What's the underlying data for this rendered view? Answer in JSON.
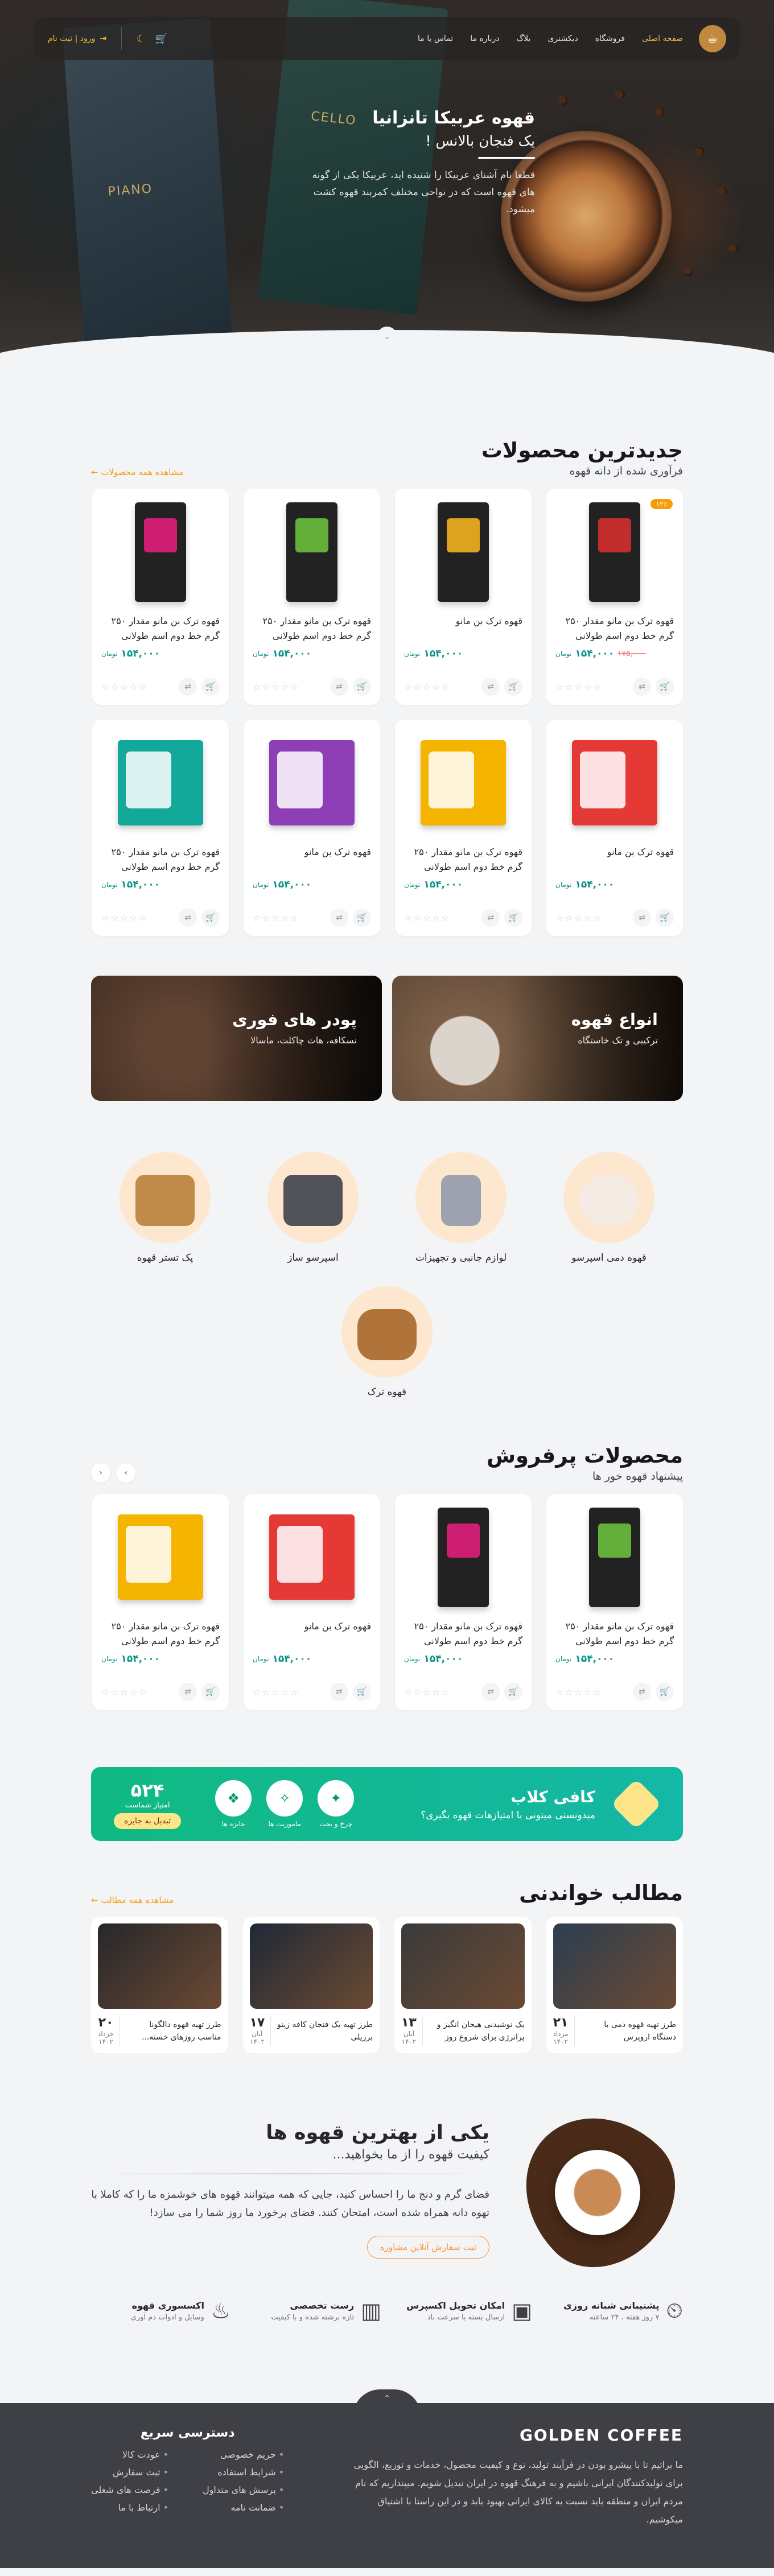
{
  "nav": {
    "menu": [
      "صفحه اصلی",
      "فروشگاه",
      "دیکشنری",
      "بلاگ",
      "درباره ما",
      "تماس با ما"
    ],
    "login": "ورود | ثبت نام"
  },
  "hero": {
    "title": "قهوه عربیکا تانزانیا",
    "subtitle": "یک فنجان بالانس !",
    "desc": "قطعا نام آشنای عربیکا را شنیده اید، عربیکا یکی از گونه های قهوه است که در نواحی مختلف کمربند قهوه کشت میشود.",
    "bag1_label": "PIANO",
    "bag2_label": "CELLO"
  },
  "latest": {
    "title": "جدیدترین محصولات",
    "sub": "فرآوری شده از دانه قهوه",
    "link": "مشاهده همه محصولات",
    "products": [
      {
        "name": "قهوه ترک بن مانو مقدار ۲۵۰ گرم خط دوم اسم طولانی",
        "price": "۱۵۴,۰۰۰",
        "old": "۱۷۵,۰۰۰",
        "badge": "۱۲٪",
        "color": "#d32f2f",
        "kind": "bag"
      },
      {
        "name": "قهوه ترک بن مانو",
        "price": "۱۵۴,۰۰۰",
        "color": "#f2b01e",
        "kind": "bag"
      },
      {
        "name": "قهوه ترک بن مانو مقدار ۲۵۰ گرم خط دوم اسم طولانی",
        "price": "۱۵۴,۰۰۰",
        "color": "#6abf3c",
        "kind": "bag"
      },
      {
        "name": "قهوه ترک بن مانو مقدار ۲۵۰ گرم خط دوم اسم طولانی",
        "price": "۱۵۴,۰۰۰",
        "color": "#e01e7a",
        "kind": "bag"
      },
      {
        "name": "قهوه ترک بن مانو",
        "price": "۱۵۴,۰۰۰",
        "color": "#e53935",
        "kind": "box"
      },
      {
        "name": "قهوه ترک بن مانو مقدار ۲۵۰ گرم خط دوم اسم طولانی",
        "price": "۱۵۴,۰۰۰",
        "color": "#f4b400",
        "kind": "box"
      },
      {
        "name": "قهوه ترک بن مانو",
        "price": "۱۵۴,۰۰۰",
        "color": "#8e3fb5",
        "kind": "box"
      },
      {
        "name": "قهوه ترک بن مانو مقدار ۲۵۰ گرم خط دوم اسم طولانی",
        "price": "۱۵۴,۰۰۰",
        "color": "#12a89a",
        "kind": "box"
      }
    ],
    "unit": "تومان"
  },
  "banners": [
    {
      "title": "انواع قهوه",
      "sub": "ترکیبی و تک خاستگاه"
    },
    {
      "title": "پودر های فوری",
      "sub": "نسکافه، هات چاکلت، ماسالا"
    }
  ],
  "categories": [
    "قهوه دمی اسپرسو",
    "لوازم جانبی و تجهیزات",
    "اسپرسو ساز",
    "پک تستر قهوه",
    "قهوه ترک"
  ],
  "bestsellers": {
    "title": "محصولات پرفروش",
    "sub": "پیشنهاد قهوه خور ها",
    "products": [
      {
        "name": "قهوه ترک بن مانو مقدار ۲۵۰ گرم خط دوم اسم طولانی",
        "price": "۱۵۴,۰۰۰",
        "color": "#6abf3c",
        "kind": "bag"
      },
      {
        "name": "قهوه ترک بن مانو مقدار ۲۵۰ گرم خط دوم اسم طولانی",
        "price": "۱۵۴,۰۰۰",
        "color": "#e01e7a",
        "kind": "bag"
      },
      {
        "name": "قهوه ترک بن مانو",
        "price": "۱۵۴,۰۰۰",
        "color": "#e53935",
        "kind": "box"
      },
      {
        "name": "قهوه ترک بن مانو مقدار ۲۵۰ گرم خط دوم اسم طولانی",
        "price": "۱۵۴,۰۰۰",
        "color": "#f4b400",
        "kind": "box"
      }
    ]
  },
  "club": {
    "title": "کافی کلاب",
    "sub": "میدونستی میتونی با امتیازهات قهوه بگیری؟",
    "acts": [
      "چرخ و بخت",
      "ماموریت ها",
      "جایزه ها"
    ],
    "points": "۵۲۴",
    "points_label": "امتیاز شماست",
    "points_btn": "تبدیل به جایزه"
  },
  "blog": {
    "title": "مطالب خواندنی",
    "link": "مشاهده همه مطالب",
    "posts": [
      {
        "title": "طرز تهیه قهوه دمی با دستگاه اروپرس",
        "day": "۲۱",
        "month": "مرداد",
        "year": "۱۴۰۲"
      },
      {
        "title": "یک نوشیدنی هیجان انگیز و پرانرژی برای شروع روز",
        "day": "۱۳",
        "month": "آبان",
        "year": "۱۴۰۲"
      },
      {
        "title": "طرز تهیه یک فنجان کافه زینو برزیلی",
        "day": "۱۷",
        "month": "آبان",
        "year": "۱۴۰۲"
      },
      {
        "title": "طرز تهیه قهوه دالگونا مناسب روزهای خسته...",
        "day": "۲۰",
        "month": "خرداد",
        "year": "۱۴۰۲"
      }
    ]
  },
  "about": {
    "title": "یکی از بهترین قهوه ها",
    "sub": "کیفیت قهوه را از ما بخواهید...",
    "text": "فضای گرم و دنج ما را احساس کنید، جایی که همه میتوانند قهوه های خوشمزه ما را که کاملا با تهوه دانه همراه شده است، امتحان کنند. فضای برخورد ما روز شما را می سازد!",
    "btn": "آنلاین مشاوره",
    "btn_prefix": "ثبت سفارش"
  },
  "services": [
    {
      "t": "پشتیبانی شبانه روزی",
      "s": "۷ روز هفته ، ۲۴ ساعته"
    },
    {
      "t": "امکان تحویل اکسپرس",
      "s": "ارسال بسته با سرعت باد"
    },
    {
      "t": "رست تخصصی",
      "s": "تازه برشته شده و با کیفیت"
    },
    {
      "t": "اکسسوری قهوه",
      "s": "وسایل و ادوات دم آوری"
    }
  ],
  "footer": {
    "logo": "GOLDEN COFFEE",
    "desc": "ما براتیم تا با پیشرو بودن در فرآیند تولید، نوع و کیفیت محصول، خدمات و توزیع، الگویی برای تولیدکنندگان ایرانی باشیم و به فرهنگ قهوه در ایران تبدیل شویم. میپنداریم که نام مردم ایران و منطقه باید نسبت به کالای ایرانی بهبود یابد و در این راستا با اشتیاق میکوشیم.",
    "quick_title": "دسترسی سریع",
    "col1": [
      "حریم خصوصی",
      "شرایط استفاده",
      "پرسش های متداول",
      "ضمانت نامه"
    ],
    "col2": [
      "عودت کالا",
      "ثبت سفارش",
      "فرصت های شغلی",
      "ارتباط با ما"
    ]
  }
}
